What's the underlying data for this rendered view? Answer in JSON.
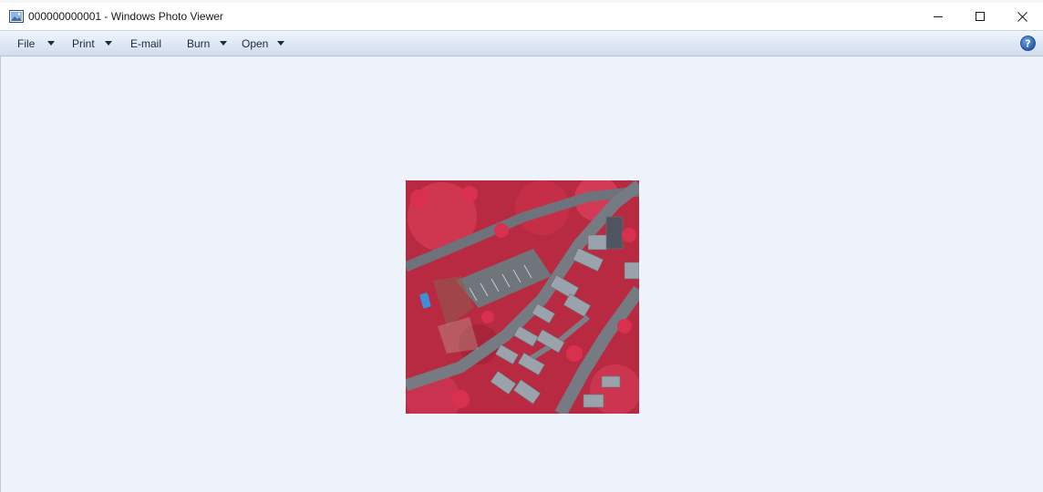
{
  "window": {
    "title": "000000000001 - Windows Photo Viewer",
    "icon": "photo-viewer-app-icon"
  },
  "window_controls": {
    "minimize_icon": "minimize-icon",
    "maximize_icon": "maximize-icon",
    "close_icon": "close-icon"
  },
  "menu": {
    "items": [
      {
        "label": "File",
        "has_dropdown": true
      },
      {
        "label": "Print",
        "has_dropdown": true
      },
      {
        "label": "E-mail",
        "has_dropdown": false
      },
      {
        "label": "Burn",
        "has_dropdown": true
      },
      {
        "label": "Open",
        "has_dropdown": true
      }
    ],
    "help_icon": "help-icon"
  },
  "image": {
    "description_icon": "aerial-false-color-infrared-photo",
    "colors": {
      "vegetation": "#c4283f",
      "roads": "#6e727a",
      "rooftops": "#9aa3ab",
      "pool": "#3f8fd6"
    }
  },
  "colors": {
    "viewer_background": "#eef2fa",
    "menubar_top": "#f1f5fb",
    "menubar_bottom": "#d2deee",
    "help_blue": "#2b5fb5"
  }
}
